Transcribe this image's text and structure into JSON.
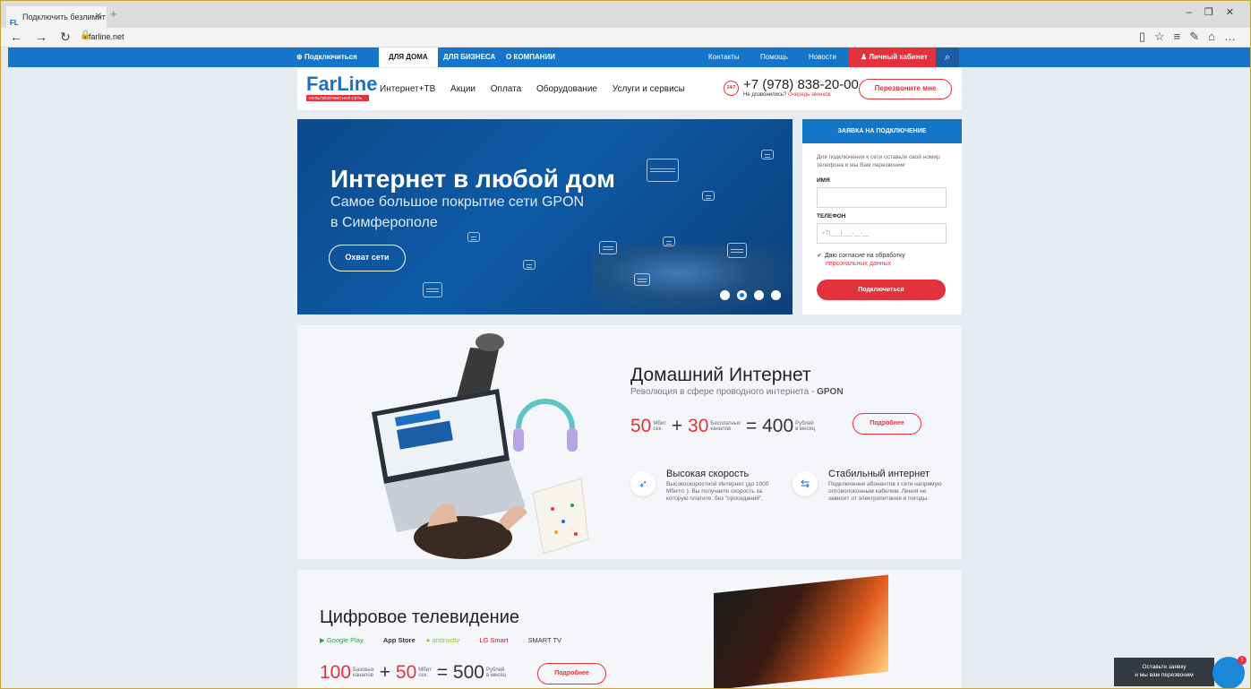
{
  "browser": {
    "tab_title": "Подключить безлимит",
    "tab_icon": "FL",
    "url": "farline.net"
  },
  "topnav": {
    "connect": "Подключиться",
    "tabs": [
      "ДЛЯ ДОМА",
      "ДЛЯ БИЗНЕСА",
      "О КОМПАНИИ"
    ],
    "links": [
      "Контакты",
      "Помощь",
      "Новости"
    ],
    "cabinet": "Личный кабинет"
  },
  "header": {
    "logo_name": "FarLine",
    "logo_tagline": "МУЛЬТИСЕРВИСНАЯ СЕТЬ",
    "menu": [
      "Интернет+ТВ",
      "Акции",
      "Оплата",
      "Оборудование",
      "Услуги и сервисы"
    ],
    "badge": "24/7",
    "phone": "+7 (978) 838-20-00",
    "phone_sub": "Не дозвонились?",
    "phone_sub_link": "Очередь звонков",
    "callback": "Перезвоните мне"
  },
  "hero": {
    "title": "Интернет в любой дом",
    "line1": "Самое большое покрытие сети GPON",
    "line2": "в Симферополе",
    "button": "Охват сети",
    "slides": 4,
    "active_slide": 2
  },
  "form": {
    "title": "ЗАЯВКА НА ПОДКЛЮЧЕНИЕ",
    "intro": "Для подключения к сети оставьте свой номер телефона и мы Вам перезвоним",
    "name_label": "ИМЯ",
    "phone_label": "ТЕЛЕФОН",
    "phone_placeholder": "+7(___)___-__-__",
    "agree": "Даю согласие на обработку",
    "agree_link": "персональных данных",
    "submit": "Подключиться"
  },
  "home_internet": {
    "title": "Домашний Интернет",
    "subtitle": "Революция в сфере проводного интернета -",
    "subtitle_bold": "GPON",
    "speed": "50",
    "speed_unit_1": "Мбит",
    "speed_unit_2": "сек.",
    "channels": "30",
    "channels_unit_1": "Бесплатных",
    "channels_unit_2": "каналов",
    "price": "400",
    "price_unit_1": "Рублей",
    "price_unit_2": "в месяц",
    "more": "Подробнее",
    "features": [
      {
        "title": "Высокая скорость",
        "text": "Высокоскоростной Интернет (до 1000 Мбит/с ). Вы получаете скорость за которую платите, без \"проседаний\"."
      },
      {
        "title": "Стабильный интернет",
        "text": "Подключение абонентов к сети напрямую оптоволоконным кабелем. Линия не зависит от электропитания и погоды."
      }
    ]
  },
  "tv": {
    "title": "Цифровое телевидение",
    "platforms": [
      "Google Play",
      "App Store",
      "androidtv",
      "LG Smart",
      "SMART TV"
    ],
    "channels": "100",
    "channels_unit_1": "Базовых",
    "channels_unit_2": "каналов",
    "speed": "50",
    "speed_unit_1": "Мбит",
    "speed_unit_2": "сек.",
    "price": "500",
    "price_unit_1": "Рублей",
    "price_unit_2": "в месяц",
    "more": "Подробнее"
  },
  "chat": {
    "line1": "Оставьте заявку",
    "line2": "и мы вам перезвоним",
    "count": "1"
  },
  "colors": {
    "brand_blue": "#1475c9",
    "accent_red": "#e3313e"
  }
}
